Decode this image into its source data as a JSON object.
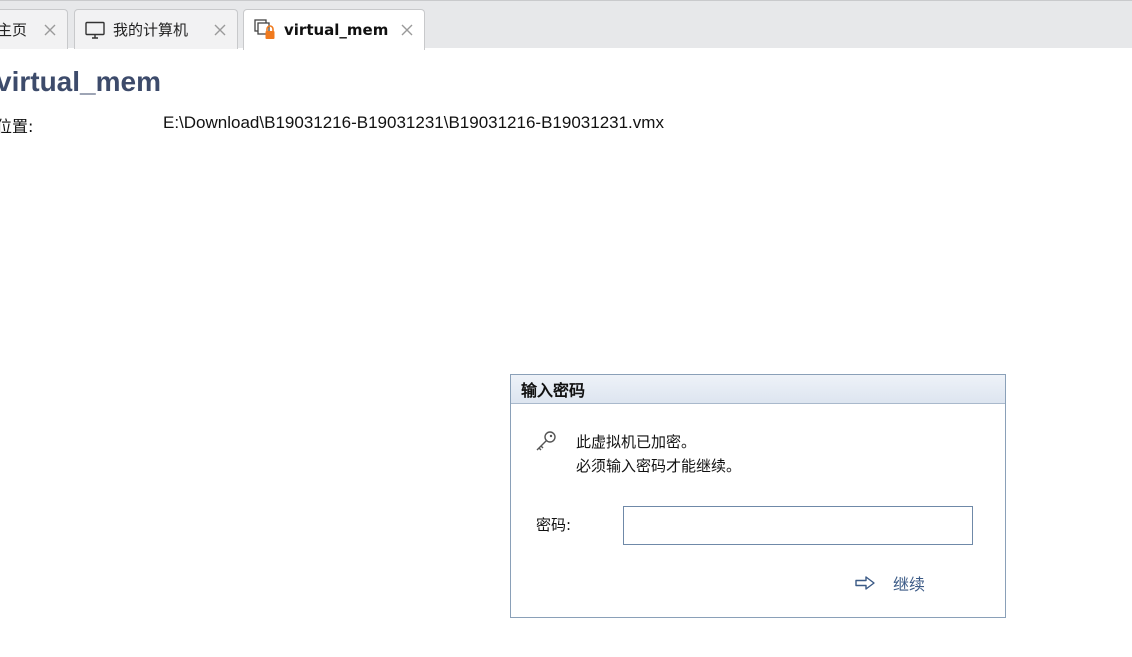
{
  "tabs": [
    {
      "label": "主页",
      "icon": "home-icon",
      "active": false
    },
    {
      "label": "我的计算机",
      "icon": "monitor-icon",
      "active": false
    },
    {
      "label": "virtual_mem",
      "icon": "locked-vm-icon",
      "active": true
    }
  ],
  "vm": {
    "title": "virtual_mem",
    "location_label": "位置:",
    "location_value": "E:\\Download\\B19031216-B19031231\\B19031216-B19031231.vmx"
  },
  "dialog": {
    "title": "输入密码",
    "message_line1": "此虚拟机已加密。",
    "message_line2": "必须输入密码才能继续。",
    "password_label": "密码:",
    "password_value": "",
    "continue_label": "继续",
    "icons": {
      "message": "key-icon",
      "continue": "arrow-right-icon"
    }
  },
  "colors": {
    "title": "#3d4b6b",
    "accent_lock": "#f07a1e",
    "link": "#3b5a86",
    "dialog_border": "#8aa0b8"
  }
}
